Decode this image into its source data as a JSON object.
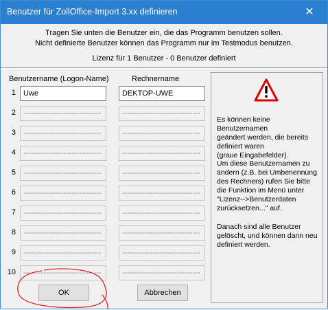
{
  "window": {
    "title": "Benutzer für ZollOffice-Import 3.xx definieren"
  },
  "intro": {
    "line1": "Tragen Sie unten die Benutzer ein, die das Programm benutzen sollen.",
    "line2": "Nicht definierte Benutzer können das Programm nur im Testmodus benutzen."
  },
  "license": {
    "text": "Lizenz für 1 Benutzer - 0 Benutzer definiert"
  },
  "columns": {
    "username": "Benutzername (Logon-Name)",
    "computer": "Rechnername"
  },
  "users": [
    {
      "num": "1",
      "username": "Uwe",
      "computer": "DEKTOP-UWE",
      "active": true
    },
    {
      "num": "2",
      "username": "-------------------------------",
      "computer": "-------------------------------",
      "active": false
    },
    {
      "num": "3",
      "username": "-------------------------------",
      "computer": "-------------------------------",
      "active": false
    },
    {
      "num": "4",
      "username": "-------------------------------",
      "computer": "-------------------------------",
      "active": false
    },
    {
      "num": "5",
      "username": "-------------------------------",
      "computer": "-------------------------------",
      "active": false
    },
    {
      "num": "6",
      "username": "-------------------------------",
      "computer": "-------------------------------",
      "active": false
    },
    {
      "num": "7",
      "username": "-------------------------------",
      "computer": "-------------------------------",
      "active": false
    },
    {
      "num": "8",
      "username": "-------------------------------",
      "computer": "-------------------------------",
      "active": false
    },
    {
      "num": "9",
      "username": "-------------------------------",
      "computer": "-------------------------------",
      "active": false
    },
    {
      "num": "10",
      "username": "-------------------------------",
      "computer": "-------------------------------",
      "active": false
    }
  ],
  "info": {
    "icon": "warning-icon",
    "paragraph1": [
      "Es können keine Benutzernamen",
      "geändert werden, die bereits",
      "definiert waren",
      "(graue Eingabefelder)."
    ],
    "paragraph2": [
      "Um diese Benutzernamen zu",
      "ändern (z.B. bei Umbenennung",
      "des Rechners) rufen Sie bitte",
      "die Funktion im Menü unter",
      "\"Lizenz-->Benutzerdaten",
      "zurücksetzen...\" auf."
    ],
    "paragraph3": [
      "Danach sind alle Benutzer",
      "gelöscht, und können dann neu",
      "definiert werden."
    ]
  },
  "buttons": {
    "ok": "OK",
    "cancel": "Abbrechen"
  },
  "colors": {
    "titlebar": "#2b7fd0",
    "annotation": "#e0202a",
    "warning": "#e00000"
  }
}
